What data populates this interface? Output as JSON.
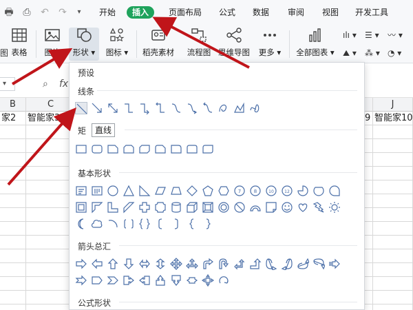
{
  "ribbon": {
    "tabs": [
      "开始",
      "插入",
      "页面布局",
      "公式",
      "数据",
      "审阅",
      "视图",
      "开发工具"
    ],
    "active_tab": "插入",
    "tools": {
      "table": "表格",
      "picture": "图片",
      "shape": "形状",
      "icon": "图标",
      "template": "稻壳素材",
      "flowchart": "流程图",
      "mindmap": "思维导图",
      "more": "更多",
      "allcharts": "全部图表"
    }
  },
  "formula": {
    "fx": "fx"
  },
  "grid": {
    "col_b": "B",
    "col_c": "C",
    "col_j": "J",
    "cell_b1": "家2",
    "cell_c1": "智能家3",
    "cell_i1": "9",
    "cell_j1": "智能家10"
  },
  "shape_panel": {
    "preset": "预设",
    "lines": "线条",
    "rect": "矩",
    "basic": "基本形状",
    "arrows": "箭头总汇",
    "formula": "公式形状",
    "tooltip": "直线"
  },
  "colors": {
    "accent": "#1fa35c",
    "shape_stroke": "#4b6fa8",
    "annotation": "#c0151a"
  }
}
